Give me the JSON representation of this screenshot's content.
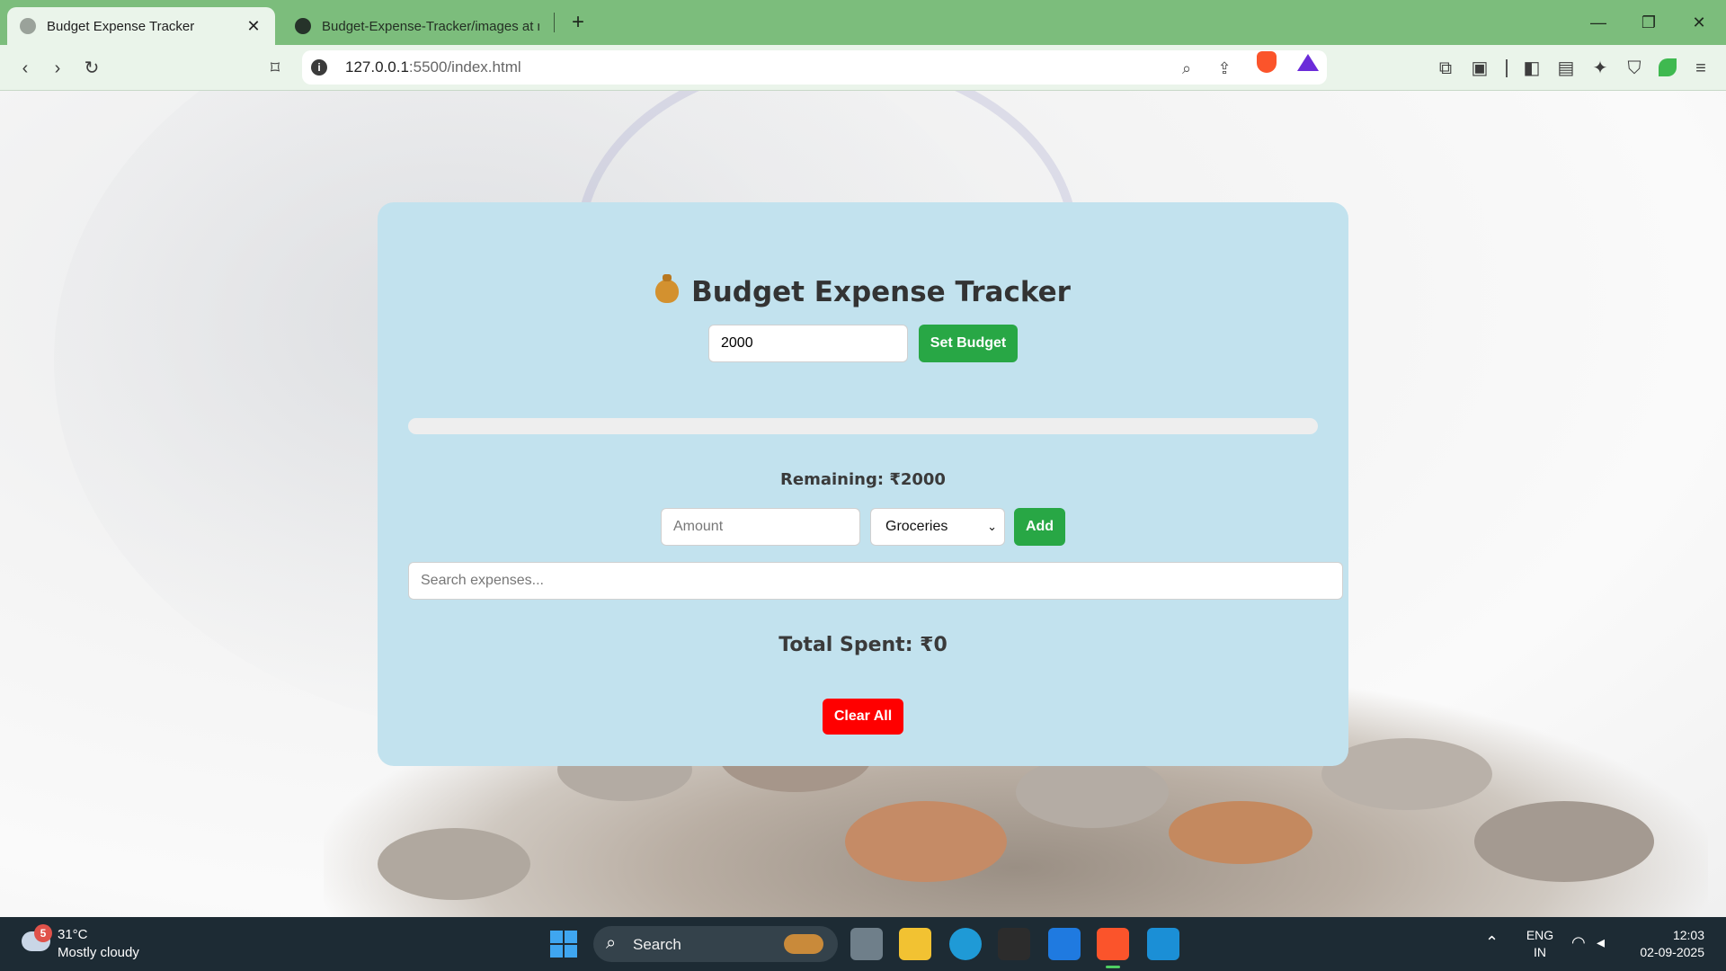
{
  "browser": {
    "tabs": [
      {
        "title": "Budget Expense Tracker",
        "active": true
      },
      {
        "title": "Budget-Expense-Tracker/images at m",
        "active": false
      }
    ],
    "url_host": "127.0.0.1",
    "url_rest": ":5500/index.html"
  },
  "app": {
    "title": "Budget Expense Tracker",
    "budget_value": "2000",
    "set_budget_label": "Set Budget",
    "progress_fraction": 0,
    "remaining_text": "Remaining: ₹2000",
    "amount_placeholder": "Amount",
    "category_selected": "Groceries",
    "add_label": "Add",
    "search_placeholder": "Search expenses...",
    "total_text": "Total Spent: ₹0",
    "clear_label": "Clear All",
    "colors": {
      "card_bg": "#c2e2ee",
      "primary_button": "#28a745",
      "danger_button": "#ff0000"
    }
  },
  "taskbar": {
    "weather_badge": "5",
    "temperature": "31°C",
    "condition": "Mostly cloudy",
    "search_label": "Search",
    "lang_line1": "ENG",
    "lang_line2": "IN",
    "time": "12:03",
    "date": "02-09-2025"
  }
}
